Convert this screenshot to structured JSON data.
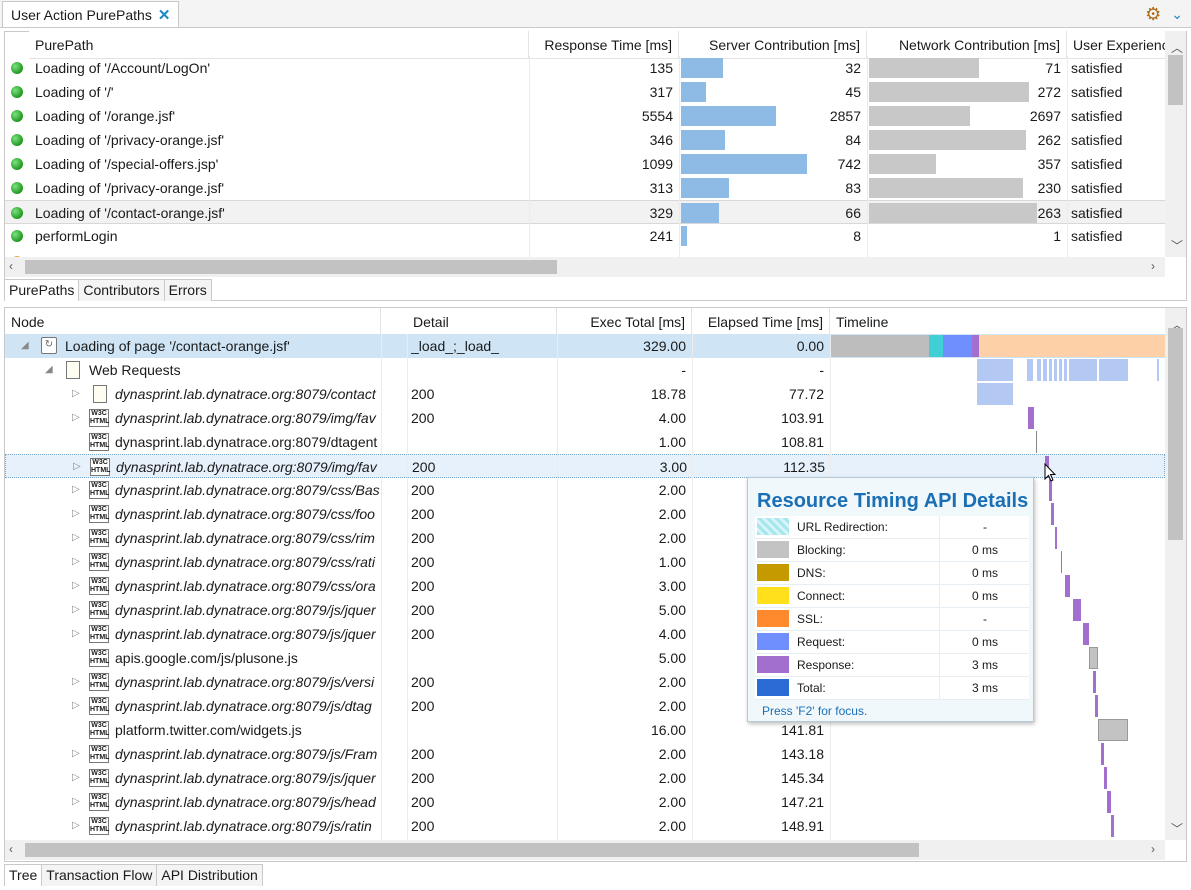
{
  "window": {
    "tab_title": "User Action PurePaths",
    "close_icon": "close-icon"
  },
  "toolbar": {
    "icons": [
      "gear-cluster-icon",
      "chevron-down-icon"
    ]
  },
  "top_table": {
    "columns": [
      "PurePath",
      "Response Time [ms]",
      "Server Contribution [ms]",
      "Network Contribution [ms]",
      "User Experienc"
    ],
    "rows": [
      {
        "name": "Loading of '/Account/LogOn'",
        "response": "135",
        "server": "32",
        "network": "71",
        "ux": "satisfied",
        "server_frac": 0.29,
        "network_frac": 0.69
      },
      {
        "name": "Loading of '/'",
        "response": "317",
        "server": "45",
        "network": "272",
        "ux": "satisfied",
        "server_frac": 0.17,
        "network_frac": 1.0
      },
      {
        "name": "Loading of '/orange.jsf'",
        "response": "5554",
        "server": "2857",
        "network": "2697",
        "ux": "satisfied",
        "server_frac": 0.65,
        "network_frac": 0.63
      },
      {
        "name": "Loading of '/privacy-orange.jsf'",
        "response": "346",
        "server": "84",
        "network": "262",
        "ux": "satisfied",
        "server_frac": 0.3,
        "network_frac": 0.98
      },
      {
        "name": "Loading of '/special-offers.jsp'",
        "response": "1099",
        "server": "742",
        "network": "357",
        "ux": "satisfied",
        "server_frac": 0.86,
        "network_frac": 0.42
      },
      {
        "name": "Loading of '/privacy-orange.jsf'",
        "response": "313",
        "server": "83",
        "network": "230",
        "ux": "satisfied",
        "server_frac": 0.33,
        "network_frac": 0.96
      },
      {
        "name": "Loading of '/contact-orange.jsf'",
        "response": "329",
        "server": "66",
        "network": "263",
        "ux": "satisfied",
        "server_frac": 0.26,
        "network_frac": 1.05
      },
      {
        "name": "performLogin",
        "response": "241",
        "server": "8",
        "network": "1",
        "ux": "satisfied",
        "server_frac": 0.04,
        "network_frac": 0.0
      }
    ]
  },
  "top_subtabs": [
    "PurePaths",
    "Contributors",
    "Errors"
  ],
  "tree_table": {
    "columns": [
      "Node",
      "Detail",
      "Exec Total [ms]",
      "Elapsed Time [ms]",
      "Timeline"
    ],
    "root": {
      "name": "Loading of page '/contact-orange.jsf'",
      "detail": "_load_;_load_",
      "exec": "329.00",
      "elapsed": "0.00"
    },
    "group": {
      "name": "Web Requests",
      "exec": "-",
      "elapsed": "-"
    },
    "rows": [
      {
        "name": "dynasprint.lab.dynatrace.org:8079/contact",
        "detail": "200",
        "exec": "18.78",
        "elapsed": "77.72",
        "icon": "document-icon",
        "expandable": true
      },
      {
        "name": "dynasprint.lab.dynatrace.org:8079/img/fav",
        "detail": "200",
        "exec": "4.00",
        "elapsed": "103.91",
        "icon": "w3c-html-icon",
        "expandable": true
      },
      {
        "name": "dynasprint.lab.dynatrace.org:8079/dtagent",
        "detail": "",
        "exec": "1.00",
        "elapsed": "108.81",
        "icon": "w3c-html-icon",
        "expandable": false
      },
      {
        "name": "dynasprint.lab.dynatrace.org:8079/img/fav",
        "detail": "200",
        "exec": "3.00",
        "elapsed": "112.35",
        "icon": "w3c-html-icon",
        "expandable": true
      },
      {
        "name": "dynasprint.lab.dynatrace.org:8079/css/Bas",
        "detail": "200",
        "exec": "2.00",
        "elapsed": "",
        "icon": "w3c-html-icon",
        "expandable": true
      },
      {
        "name": "dynasprint.lab.dynatrace.org:8079/css/foo",
        "detail": "200",
        "exec": "2.00",
        "elapsed": "",
        "icon": "w3c-html-icon",
        "expandable": true
      },
      {
        "name": "dynasprint.lab.dynatrace.org:8079/css/rim",
        "detail": "200",
        "exec": "2.00",
        "elapsed": "",
        "icon": "w3c-html-icon",
        "expandable": true
      },
      {
        "name": "dynasprint.lab.dynatrace.org:8079/css/rati",
        "detail": "200",
        "exec": "1.00",
        "elapsed": "",
        "icon": "w3c-html-icon",
        "expandable": true
      },
      {
        "name": "dynasprint.lab.dynatrace.org:8079/css/ora",
        "detail": "200",
        "exec": "3.00",
        "elapsed": "",
        "icon": "w3c-html-icon",
        "expandable": true
      },
      {
        "name": "dynasprint.lab.dynatrace.org:8079/js/jquer",
        "detail": "200",
        "exec": "5.00",
        "elapsed": "",
        "icon": "w3c-html-icon",
        "expandable": true
      },
      {
        "name": "dynasprint.lab.dynatrace.org:8079/js/jquer",
        "detail": "200",
        "exec": "4.00",
        "elapsed": "",
        "icon": "w3c-html-icon",
        "expandable": true
      },
      {
        "name": "apis.google.com/js/plusone.js",
        "detail": "",
        "exec": "5.00",
        "elapsed": "",
        "icon": "w3c-html-icon",
        "expandable": false
      },
      {
        "name": "dynasprint.lab.dynatrace.org:8079/js/versi",
        "detail": "200",
        "exec": "2.00",
        "elapsed": "",
        "icon": "w3c-html-icon",
        "expandable": true
      },
      {
        "name": "dynasprint.lab.dynatrace.org:8079/js/dtag",
        "detail": "200",
        "exec": "2.00",
        "elapsed": "",
        "icon": "w3c-html-icon",
        "expandable": true
      },
      {
        "name": "platform.twitter.com/widgets.js",
        "detail": "",
        "exec": "16.00",
        "elapsed": "141.81",
        "icon": "w3c-html-icon",
        "expandable": false
      },
      {
        "name": "dynasprint.lab.dynatrace.org:8079/js/Fram",
        "detail": "200",
        "exec": "2.00",
        "elapsed": "143.18",
        "icon": "w3c-html-icon",
        "expandable": true
      },
      {
        "name": "dynasprint.lab.dynatrace.org:8079/js/jquer",
        "detail": "200",
        "exec": "2.00",
        "elapsed": "145.34",
        "icon": "w3c-html-icon",
        "expandable": true
      },
      {
        "name": "dynasprint.lab.dynatrace.org:8079/js/head",
        "detail": "200",
        "exec": "2.00",
        "elapsed": "147.21",
        "icon": "w3c-html-icon",
        "expandable": true
      },
      {
        "name": "dynasprint.lab.dynatrace.org:8079/js/ratin",
        "detail": "200",
        "exec": "2.00",
        "elapsed": "148.91",
        "icon": "w3c-html-icon",
        "expandable": true
      }
    ]
  },
  "bottom_subtabs": [
    "Tree",
    "Transaction Flow",
    "API Distribution"
  ],
  "tooltip": {
    "title": "Resource Timing API Details",
    "rows": [
      {
        "label": "URL Redirection:",
        "value": "-",
        "color": "#b7ecf2"
      },
      {
        "label": "Blocking:",
        "value": "0 ms",
        "color": "#c3c3c3"
      },
      {
        "label": "DNS:",
        "value": "0 ms",
        "color": "#c49a00"
      },
      {
        "label": "Connect:",
        "value": "0 ms",
        "color": "#ffe01a"
      },
      {
        "label": "SSL:",
        "value": "-",
        "color": "#ff8a2e"
      },
      {
        "label": "Request:",
        "value": "0 ms",
        "color": "#6f8fff"
      },
      {
        "label": "Response:",
        "value": "3 ms",
        "color": "#a26fcf"
      },
      {
        "label": "Total:",
        "value": "3 ms",
        "color": "#2a6bd6"
      }
    ],
    "footer": "Press 'F2' for focus."
  },
  "colors": {
    "server_bar": "#8dbbe6",
    "network_bar": "#c8c8c8",
    "selection": "#cfe5f6",
    "accent": "#1a6fb5"
  }
}
